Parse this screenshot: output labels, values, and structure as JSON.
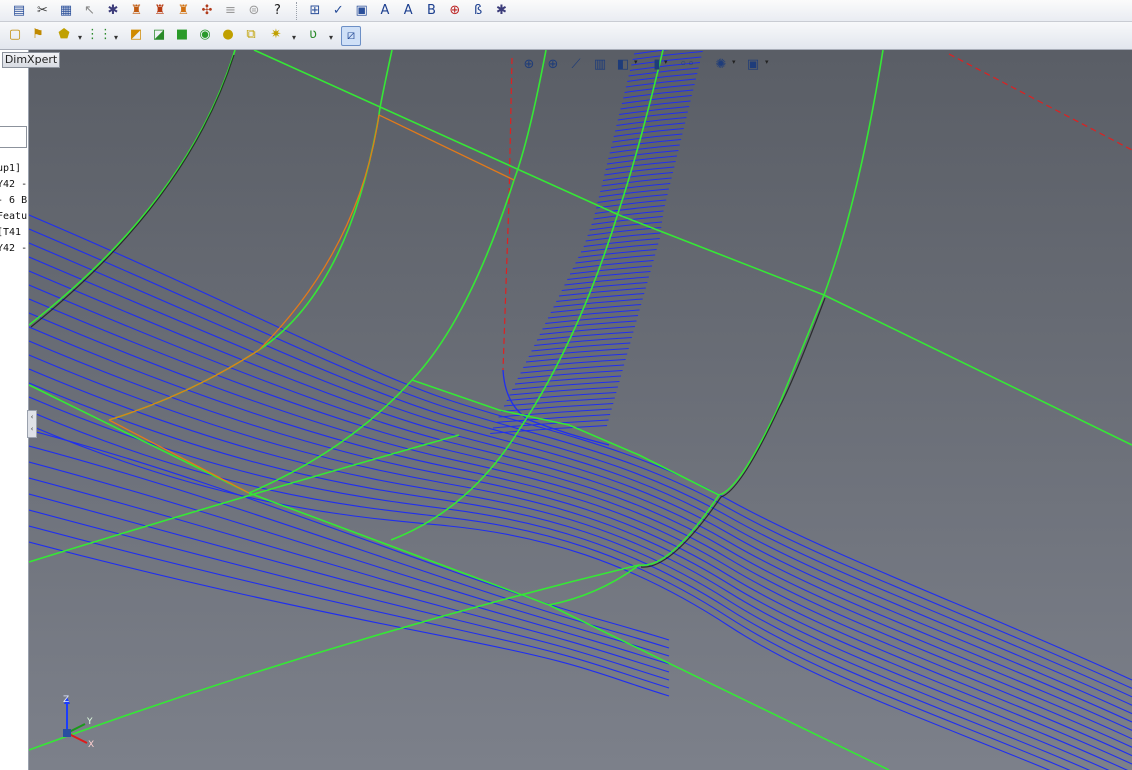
{
  "toolbar_top": {
    "buttons": [
      {
        "name": "properties-icon",
        "glyph": "▤",
        "color": "#2a4f9a"
      },
      {
        "name": "cut-icon",
        "glyph": "✂",
        "color": "#3b3b3b"
      },
      {
        "name": "document-icon",
        "glyph": "▦",
        "color": "#2a4f9a"
      },
      {
        "name": "pointer-icon",
        "glyph": "↖",
        "color": "#8a8a8a"
      },
      {
        "name": "gear-sync-icon",
        "glyph": "✱",
        "color": "#3c3c7a"
      },
      {
        "name": "stamp-icon",
        "glyph": "♜",
        "color": "#c05a10"
      },
      {
        "name": "stamp-red-icon",
        "glyph": "♜",
        "color": "#b73a10"
      },
      {
        "name": "stamp-orange-icon",
        "glyph": "♜",
        "color": "#d07010"
      },
      {
        "name": "swirl-icon",
        "glyph": "✣",
        "color": "#b13b1b"
      },
      {
        "name": "stack-icon",
        "glyph": "≡",
        "color": "#9a9a9a"
      },
      {
        "name": "layers-gray-icon",
        "glyph": "⊜",
        "color": "#9a9a9a"
      },
      {
        "name": "help-icon",
        "glyph": "?",
        "color": "#1a1a1a"
      }
    ],
    "buttons_right": [
      {
        "name": "grid-select-icon",
        "glyph": "⊞",
        "color": "#2a4f9a"
      },
      {
        "name": "check-list-icon",
        "glyph": "✓",
        "color": "#2a4f9a"
      },
      {
        "name": "document-check-icon",
        "glyph": "▣",
        "color": "#2a4f9a"
      },
      {
        "name": "magnifier-a-icon",
        "glyph": "A",
        "color": "#1c3f8f"
      },
      {
        "name": "magnifier-b-icon",
        "glyph": "A",
        "color": "#1c3f8f"
      },
      {
        "name": "letter-b-icon",
        "glyph": "B",
        "color": "#1c3f8f"
      },
      {
        "name": "search-red-icon",
        "glyph": "⊕",
        "color": "#b22"
      },
      {
        "name": "search-b-icon",
        "glyph": "ß",
        "color": "#1c3f8f"
      },
      {
        "name": "gear-sync-right-icon",
        "glyph": "✱",
        "color": "#3c3c7a"
      }
    ]
  },
  "toolbar_second": {
    "buttons": [
      {
        "name": "sketch-frame-icon",
        "glyph": "▢",
        "color": "#c08a00"
      },
      {
        "name": "bookmark-icon",
        "glyph": "⚑",
        "color": "#c08a00"
      },
      {
        "name": "polygon-icon",
        "glyph": "⬟",
        "color": "#c0a000"
      },
      {
        "name": "pattern-dots-icon",
        "glyph": "⋮⋮",
        "color": "#2a8a2a"
      },
      {
        "name": "extrude-icon",
        "glyph": "◩",
        "color": "#d08a00"
      },
      {
        "name": "loft-icon",
        "glyph": "◪",
        "color": "#2a8a2a"
      },
      {
        "name": "box-icon",
        "glyph": "■",
        "color": "#2a9a2a"
      },
      {
        "name": "cylinder-icon",
        "glyph": "◉",
        "color": "#2a9a2a"
      },
      {
        "name": "sphere-icon",
        "glyph": "●",
        "color": "#c0a000"
      },
      {
        "name": "clip-icon",
        "glyph": "⧉",
        "color": "#c0a000"
      },
      {
        "name": "sparkle-icon",
        "glyph": "✷",
        "color": "#c0a000"
      },
      {
        "name": "curve-icon",
        "glyph": "ʋ",
        "color": "#2a8a2a"
      },
      {
        "name": "display-toggle-icon",
        "glyph": "⧄",
        "color": "#2a4f9a"
      }
    ]
  },
  "left_panel": {
    "tab_label": "DimXpert",
    "tree_items": [
      "up1]",
      "Y42 -",
      "- 6 B",
      "Featu",
      "[T41",
      "Y42 -"
    ]
  },
  "heads_up_toolbar": {
    "buttons": [
      {
        "name": "zoom-to-fit-icon",
        "glyph": "⊕"
      },
      {
        "name": "zoom-area-icon",
        "glyph": "⊕"
      },
      {
        "name": "previous-view-icon",
        "glyph": "⟋"
      },
      {
        "name": "section-view-icon",
        "glyph": "▥"
      },
      {
        "name": "view-orientation-icon",
        "glyph": "◧"
      },
      {
        "name": "display-style-icon",
        "glyph": "▮"
      },
      {
        "name": "hide-show-icon",
        "glyph": "◦◦"
      },
      {
        "name": "appearance-icon",
        "glyph": "✺"
      },
      {
        "name": "scene-icon",
        "glyph": "▣"
      }
    ]
  },
  "triad": {
    "x_label": "X",
    "y_label": "Y",
    "z_label": "Z"
  },
  "colors": {
    "viewport_bg_top": "#5a5e66",
    "viewport_bg_bottom": "#7c808a",
    "curve_green": "#35e835",
    "curve_blue": "#1f2ef0",
    "curve_dark": "#1c1c1c",
    "dashed_red": "#e02020",
    "edge_orange": "#e27a1a"
  }
}
